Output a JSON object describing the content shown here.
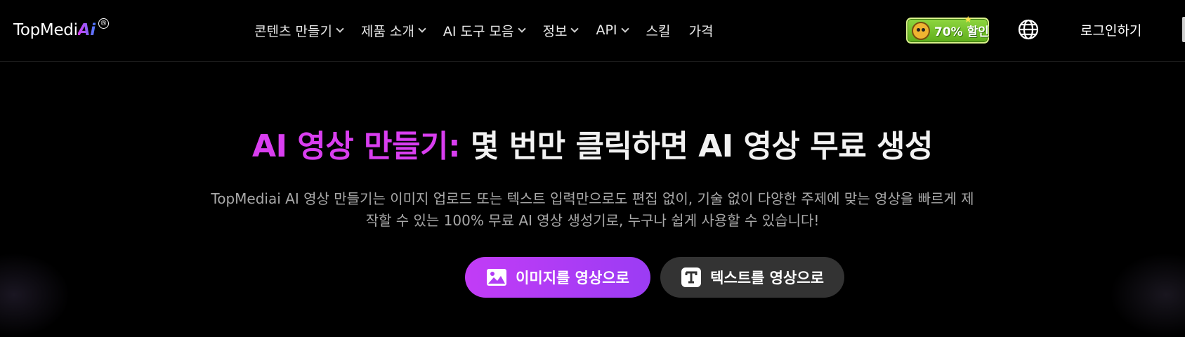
{
  "header": {
    "logo_text": "TopMedi",
    "logo_ai": "Ai",
    "logo_mark": "®",
    "nav": [
      {
        "label": "콘텐츠 만들기",
        "dropdown": true
      },
      {
        "label": "제품 소개",
        "dropdown": true
      },
      {
        "label": "AI 도구 모음",
        "dropdown": true
      },
      {
        "label": "정보",
        "dropdown": true
      },
      {
        "label": "API",
        "dropdown": true
      },
      {
        "label": "스킬",
        "dropdown": false
      },
      {
        "label": "가격",
        "dropdown": false
      }
    ],
    "promo_label": "70% 할인",
    "login_label": "로그인하기",
    "icons": {
      "globe": "globe-icon",
      "promo": "mascot-icon"
    }
  },
  "hero": {
    "title_accent": "AI 영상 만들기:",
    "title_rest": " 몇 번만 클릭하면 AI 영상 무료 생성",
    "description": "TopMediai AI 영상 만들기는 이미지 업로드 또는 텍스트 입력만으로도 편집 없이, 기술 없이 다양한 주제에 맞는 영상을 빠르게 제작할 수 있는 100% 무료 AI 영상 생성기로, 누구나 쉽게 사용할 수 있습니다!",
    "buttons": {
      "image_to_video": "이미지를 영상으로",
      "text_to_video": "텍스트를 영상으로"
    }
  },
  "colors": {
    "accent": "#d93ef0",
    "background": "#000000",
    "secondary_button": "#333333",
    "promo_green": "#7cc734"
  }
}
